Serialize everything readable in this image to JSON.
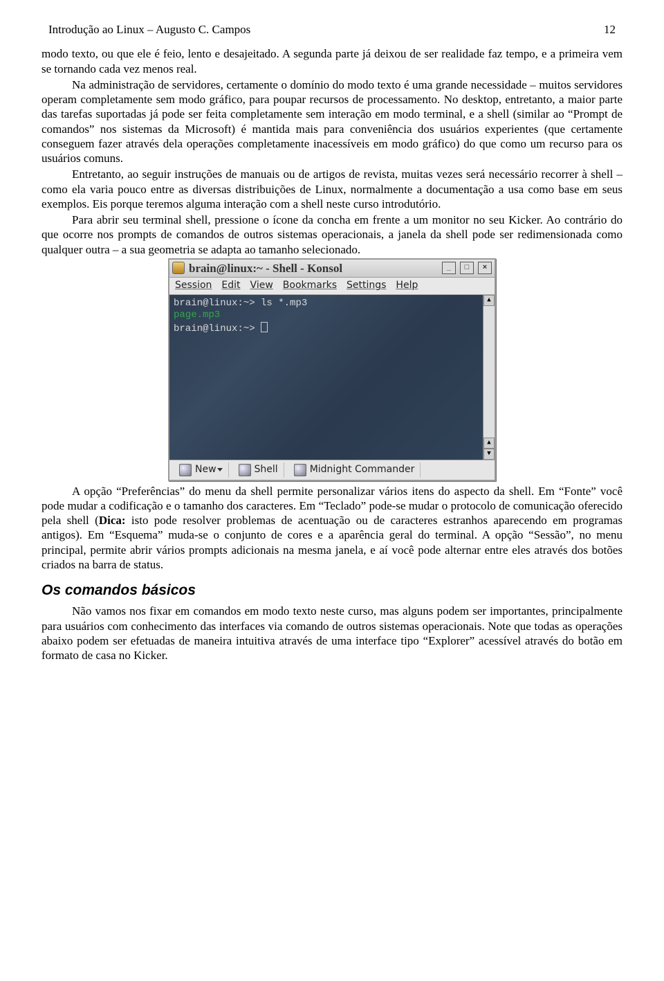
{
  "header": {
    "title": "Introdução ao Linux – Augusto C. Campos",
    "page": "12"
  },
  "para1": "modo texto,  ou que ele é feio, lento e desajeitado. A segunda parte já deixou de ser realidade faz tempo, e a primeira vem se tornando cada vez menos real.",
  "para2": "Na administração de servidores, certamente o domínio do modo texto é uma grande necessidade – muitos servidores operam completamente sem modo gráfico, para poupar recursos de processamento. No desktop, entretanto, a maior parte das tarefas suportadas já pode ser feita completamente sem interação em modo terminal, e a shell (similar ao “Prompt de comandos” nos sistemas da Microsoft) é mantida mais para conveniência dos usuários experientes (que certamente conseguem fazer através dela operações completamente inacessíveis em modo gráfico)  do que como um recurso para os usuários comuns.",
  "para3": "Entretanto, ao seguir instruções de manuais ou de artigos de revista, muitas vezes será necessário recorrer à shell – como ela varia pouco entre as diversas distribuições de Linux, normalmente a documentação a usa como base em seus exemplos. Eis porque teremos alguma interação com a shell neste curso introdutório.",
  "para4": "Para abrir seu terminal shell, pressione o ícone da concha em frente a um monitor no seu Kicker. Ao contrário do que ocorre nos prompts de comandos de outros sistemas operacionais, a janela da shell pode ser redimensionada como qualquer outra – a sua geometria se adapta ao tamanho selecionado.",
  "konsole": {
    "title": "brain@linux:~ - Shell - Konsol",
    "menus": [
      "Session",
      "Edit",
      "View",
      "Bookmarks",
      "Settings",
      "Help"
    ],
    "line1_prompt": "brain@linux:~> ",
    "line1_cmd": "ls *.mp3",
    "line2": "page.mp3",
    "line3_prompt": "brain@linux:~> ",
    "status": {
      "new": "New",
      "shell": "Shell",
      "mc": "Midnight Commander"
    }
  },
  "para5": "A opção “Preferências” do menu da shell permite personalizar vários itens do aspecto da shell. Em “Fonte” você pode mudar a codificação e o tamanho dos caracteres. Em “Teclado” pode-se mudar o protocolo de comunicação oferecido pela shell (",
  "para5_bold": "Dica:",
  "para5_rest": " isto pode resolver problemas de acentuação ou de caracteres estranhos aparecendo em programas antigos). Em “Esquema” muda-se o conjunto de cores e a aparência geral do terminal. A opção “Sessão”, no menu principal, permite abrir vários prompts adicionais na mesma janela, e aí você pode alternar entre eles através dos botões criados na barra de status.",
  "section": "Os comandos básicos",
  "para6": "Não vamos nos fixar em comandos em modo texto neste curso, mas alguns podem ser importantes, principalmente para usuários com conhecimento das interfaces via comando de outros sistemas operacionais. Note que todas as operações abaixo podem ser efetuadas de maneira intuitiva através de uma interface tipo “Explorer” acessível através do botão em formato de casa no Kicker."
}
